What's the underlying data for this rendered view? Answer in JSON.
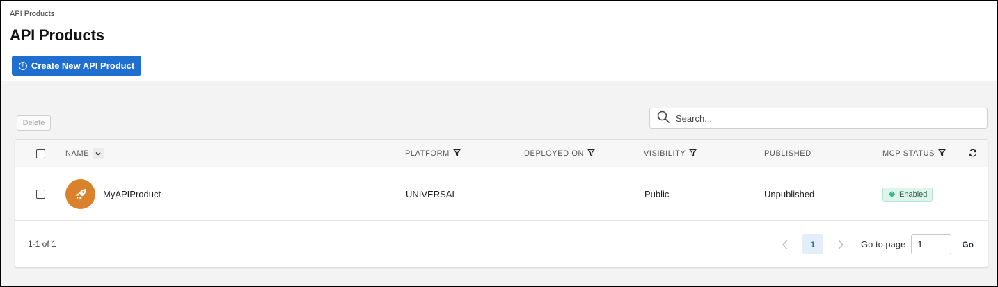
{
  "breadcrumb": "API Products",
  "page_title": "API Products",
  "create_button_label": "Create New API Product",
  "delete_button_label": "Delete",
  "search": {
    "placeholder": "Search..."
  },
  "table": {
    "columns": {
      "name": "NAME",
      "platform": "PLATFORM",
      "deployed_on": "DEPLOYED ON",
      "visibility": "VISIBILITY",
      "published": "PUBLISHED",
      "mcp_status": "MCP STATUS"
    },
    "rows": [
      {
        "name": "MyAPIProduct",
        "platform": "UNIVERSAL",
        "deployed_on": "",
        "visibility": "Public",
        "published": "Unpublished",
        "mcp_status": "Enabled",
        "avatar_icon": "rocket-icon",
        "avatar_color": "#d9822b"
      }
    ]
  },
  "pagination": {
    "range_text": "1-1 of 1",
    "current_page": "1",
    "goto_label": "Go to page",
    "goto_value": "1",
    "go_label": "Go"
  },
  "colors": {
    "primary": "#1f6fd1",
    "badge_bg": "#dff5ec",
    "avatar": "#d9822b"
  }
}
